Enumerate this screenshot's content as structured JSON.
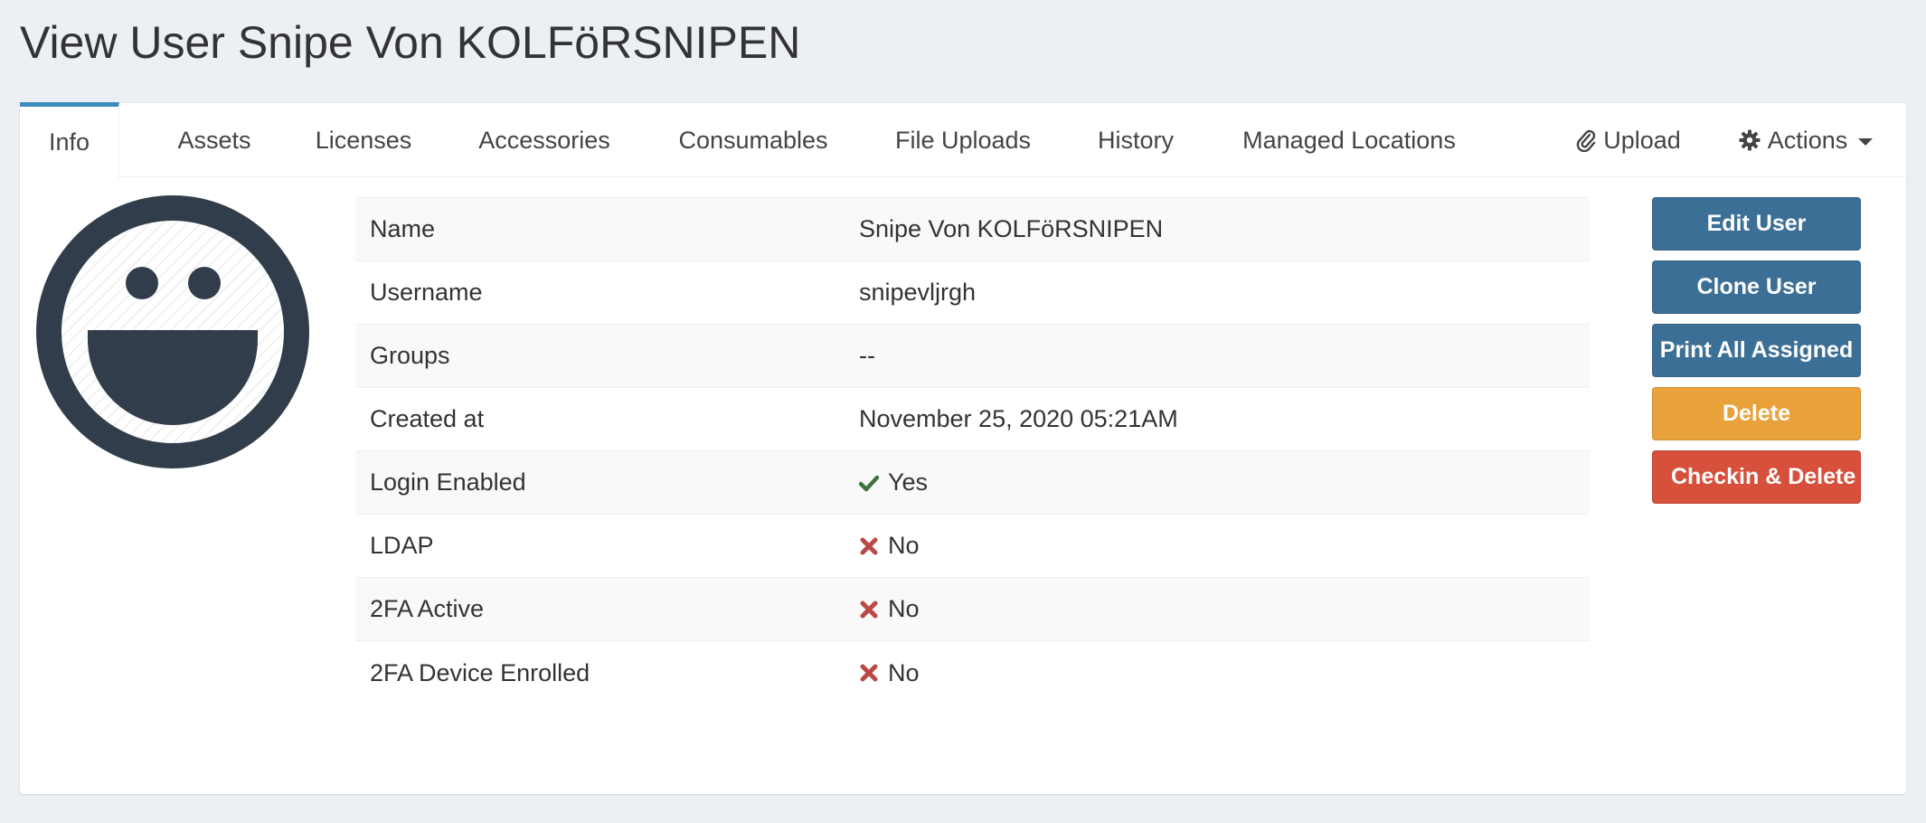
{
  "page": {
    "title": "View User Snipe Von KOLFöRSNIPEN"
  },
  "tabs": [
    {
      "label": "Info"
    },
    {
      "label": "Assets"
    },
    {
      "label": "Licenses"
    },
    {
      "label": "Accessories"
    },
    {
      "label": "Consumables"
    },
    {
      "label": "File Uploads"
    },
    {
      "label": "History"
    },
    {
      "label": "Managed Locations"
    }
  ],
  "toolbar": {
    "upload_label": "Upload",
    "upload_icon": "paperclip-icon",
    "actions_label": "Actions",
    "actions_icon": "gear-icon"
  },
  "avatar": {
    "icon": "smiley-face-icon"
  },
  "details": [
    {
      "key": "Name",
      "value": "Snipe Von KOLFöRSNIPEN",
      "status": ""
    },
    {
      "key": "Username",
      "value": "snipevljrgh",
      "status": ""
    },
    {
      "key": "Groups",
      "value": "--",
      "status": ""
    },
    {
      "key": "Created at",
      "value": "November 25, 2020 05:21AM",
      "status": ""
    },
    {
      "key": "Login Enabled",
      "value": "Yes",
      "status": "check"
    },
    {
      "key": "LDAP",
      "value": "No",
      "status": "cross"
    },
    {
      "key": "2FA Active",
      "value": "No",
      "status": "cross"
    },
    {
      "key": "2FA Device Enrolled",
      "value": "No",
      "status": "cross"
    }
  ],
  "buttons": [
    {
      "label": "Edit User",
      "color": "#3c6f96"
    },
    {
      "label": "Clone User",
      "color": "#3c6f96"
    },
    {
      "label": "Print All Assigned",
      "color": "#3c6f96"
    },
    {
      "label": "Delete",
      "color": "#e9a23b"
    },
    {
      "label": "Checkin & Delete User",
      "color": "#d6503c"
    }
  ],
  "colors": {
    "accent": "#3c8dbc",
    "check": "#3c763d",
    "cross": "#b94a48",
    "avatar_dark": "#323d4b"
  }
}
